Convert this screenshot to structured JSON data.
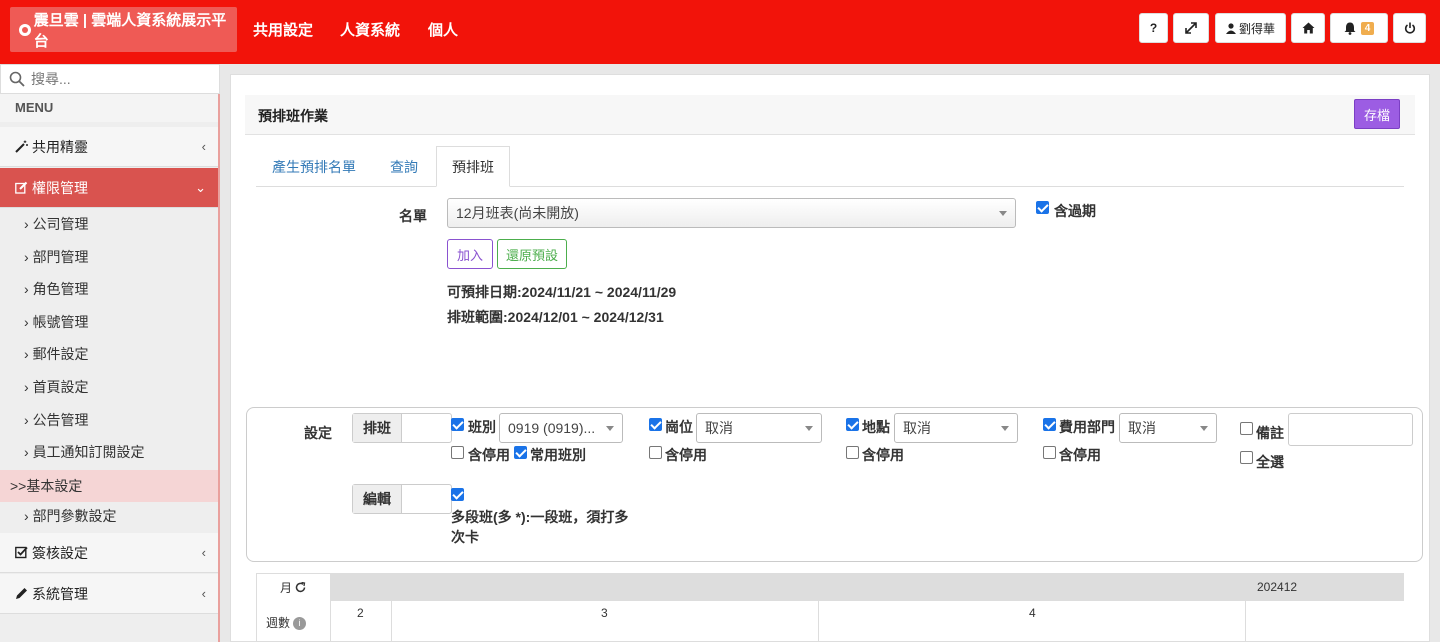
{
  "header": {
    "brand": "震旦雲 | 雲端人資系統展示平台",
    "nav": [
      "共用設定",
      "人資系統",
      "個人"
    ],
    "help_label": "?",
    "user_name": "劉得華",
    "notification_count": "4"
  },
  "sidebar": {
    "search_placeholder": "搜尋...",
    "menu_label": "MENU",
    "items": [
      {
        "label": "共用精靈",
        "icon": "magic-wand-icon"
      },
      {
        "label": "權限管理",
        "icon": "edit-icon"
      },
      {
        "label": "簽核設定",
        "icon": "checkbox-icon"
      },
      {
        "label": "系統管理",
        "icon": "pencil-icon"
      }
    ],
    "sub_items": [
      "公司管理",
      "部門管理",
      "角色管理",
      "帳號管理",
      "郵件設定",
      "首頁設定",
      "公告管理",
      "員工通知訂閱設定"
    ],
    "highlight": ">>基本設定",
    "after_highlight": "部門參數設定"
  },
  "panel": {
    "title": "預排班作業",
    "save_label": "存檔"
  },
  "tabs": [
    "產生預排名單",
    "查詢",
    "預排班"
  ],
  "form": {
    "list_label": "名單",
    "list_value": "12月班表(尚未開放)",
    "include_expired": "含過期",
    "add_label": "加入",
    "reset_label": "還原預設",
    "pre_date_text": "可預排日期:2024/11/21 ~ 2024/11/29",
    "range_text": "排班範圍:2024/12/01 ~ 2024/12/31"
  },
  "settings": {
    "label": "設定",
    "schedule_addon": "排班",
    "edit_addon": "編輯",
    "shift_label": "班別",
    "shift_value": "0919 (0919)...",
    "position_label": "崗位",
    "location_label": "地點",
    "cost_dept_label": "費用部門",
    "cancel_value": "取消",
    "include_disabled": "含停用",
    "common_shift": "常用班別",
    "note_label": "備註",
    "select_all": "全選",
    "multi_shift_text": "多段班(多 *):一段班，須打多次卡"
  },
  "calendar": {
    "month_label": "月",
    "week_label": "週數",
    "period": "202412",
    "weeks": [
      "2",
      "3",
      "4"
    ]
  },
  "colors": {
    "topbar": "#f2130a",
    "active_menu": "#d9534f",
    "save_button": "#9c5de3",
    "checkbox": "#1a73e8"
  }
}
